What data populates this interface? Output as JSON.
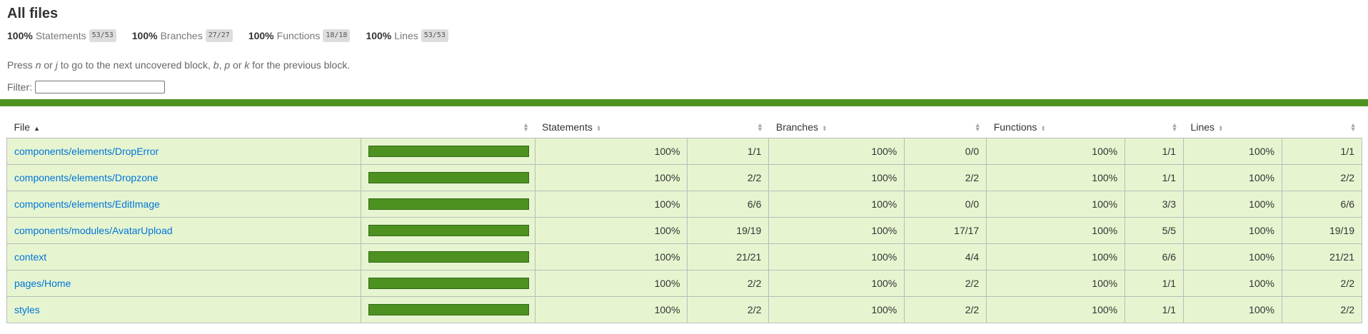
{
  "title": "All files",
  "summary": [
    {
      "pct": "100%",
      "label": "Statements",
      "frac": "53/53"
    },
    {
      "pct": "100%",
      "label": "Branches",
      "frac": "27/27"
    },
    {
      "pct": "100%",
      "label": "Functions",
      "frac": "18/18"
    },
    {
      "pct": "100%",
      "label": "Lines",
      "frac": "53/53"
    }
  ],
  "hint": {
    "p1": "Press ",
    "k1": "n",
    "p2": " or ",
    "k2": "j",
    "p3": " to go to the next uncovered block, ",
    "k3": "b",
    "p4": ", ",
    "k4": "p",
    "p5": " or ",
    "k5": "k",
    "p6": " for the previous block."
  },
  "filter": {
    "label": "Filter:",
    "value": ""
  },
  "headers": {
    "file": "File",
    "statements": "Statements",
    "branches": "Branches",
    "functions": "Functions",
    "lines": "Lines",
    "sort_arrow": "▲",
    "sort_toggle": "▲▼"
  },
  "rows": [
    {
      "file": "components/elements/DropError",
      "coverage": 1.0,
      "stmt_pct": "100%",
      "stmt": "1/1",
      "br_pct": "100%",
      "br": "0/0",
      "fn_pct": "100%",
      "fn": "1/1",
      "ln_pct": "100%",
      "ln": "1/1"
    },
    {
      "file": "components/elements/Dropzone",
      "coverage": 1.0,
      "stmt_pct": "100%",
      "stmt": "2/2",
      "br_pct": "100%",
      "br": "2/2",
      "fn_pct": "100%",
      "fn": "1/1",
      "ln_pct": "100%",
      "ln": "2/2"
    },
    {
      "file": "components/elements/EditImage",
      "coverage": 1.0,
      "stmt_pct": "100%",
      "stmt": "6/6",
      "br_pct": "100%",
      "br": "0/0",
      "fn_pct": "100%",
      "fn": "3/3",
      "ln_pct": "100%",
      "ln": "6/6"
    },
    {
      "file": "components/modules/AvatarUpload",
      "coverage": 1.0,
      "stmt_pct": "100%",
      "stmt": "19/19",
      "br_pct": "100%",
      "br": "17/17",
      "fn_pct": "100%",
      "fn": "5/5",
      "ln_pct": "100%",
      "ln": "19/19"
    },
    {
      "file": "context",
      "coverage": 1.0,
      "stmt_pct": "100%",
      "stmt": "21/21",
      "br_pct": "100%",
      "br": "4/4",
      "fn_pct": "100%",
      "fn": "6/6",
      "ln_pct": "100%",
      "ln": "21/21"
    },
    {
      "file": "pages/Home",
      "coverage": 1.0,
      "stmt_pct": "100%",
      "stmt": "2/2",
      "br_pct": "100%",
      "br": "2/2",
      "fn_pct": "100%",
      "fn": "1/1",
      "ln_pct": "100%",
      "ln": "2/2"
    },
    {
      "file": "styles",
      "coverage": 1.0,
      "stmt_pct": "100%",
      "stmt": "2/2",
      "br_pct": "100%",
      "br": "2/2",
      "fn_pct": "100%",
      "fn": "1/1",
      "ln_pct": "100%",
      "ln": "2/2"
    }
  ],
  "colors": {
    "high": "#4d9221",
    "row_bg": "#e6f5d0",
    "link": "#0074d9"
  }
}
